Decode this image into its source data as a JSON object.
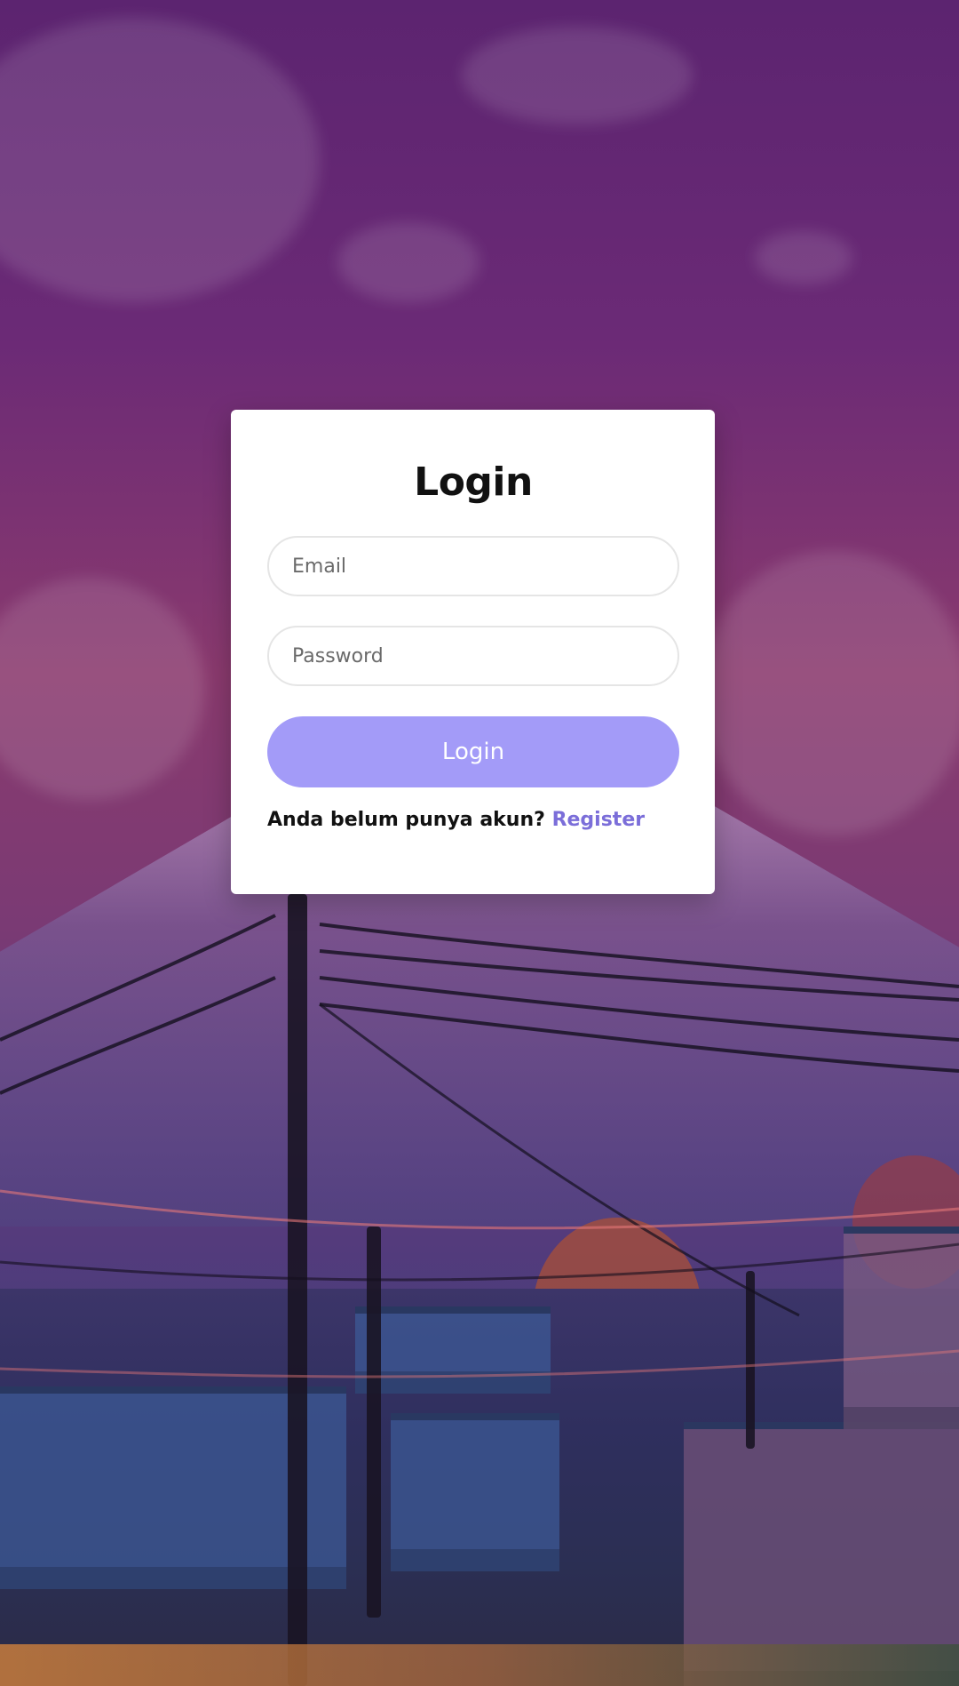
{
  "login": {
    "title": "Login",
    "email_placeholder": "Email",
    "password_placeholder": "Password",
    "button_label": "Login",
    "prompt_text": "Anda belum punya akun?",
    "register_link_label": "Register"
  },
  "colors": {
    "primary_button": "#a39bf8",
    "link": "#7b6ed9"
  }
}
